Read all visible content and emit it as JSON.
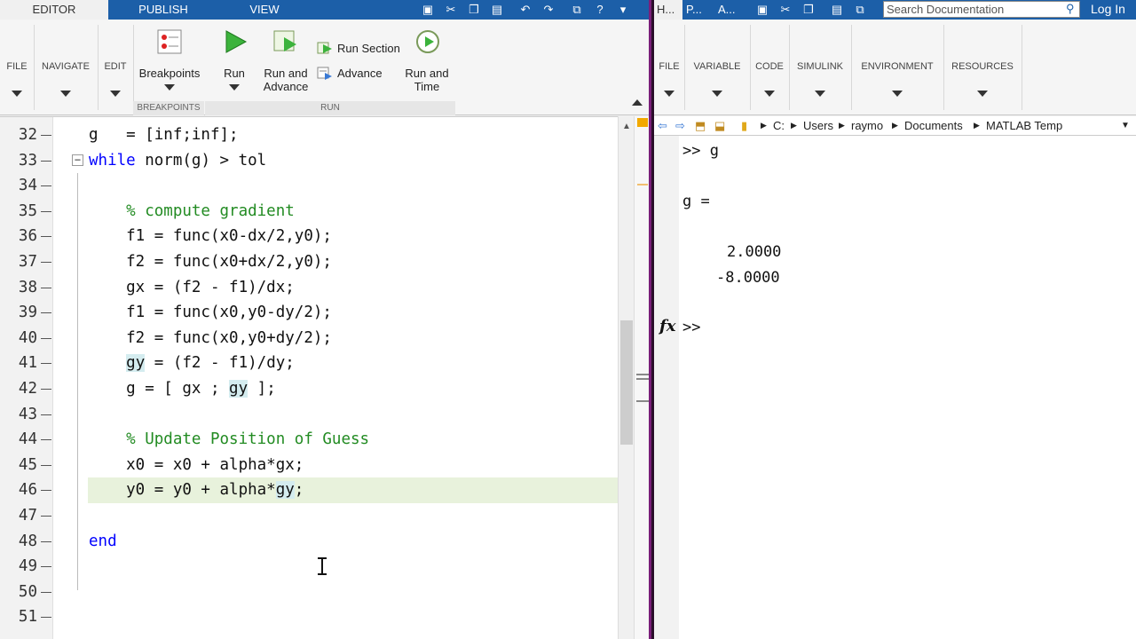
{
  "editor_window": {
    "tabs": [
      {
        "label": "EDITOR",
        "active": true
      },
      {
        "label": "PUBLISH",
        "active": false
      },
      {
        "label": "VIEW",
        "active": false
      }
    ],
    "ribbon": {
      "file": "FILE",
      "navigate": "NAVIGATE",
      "edit": "EDIT",
      "breakpoints": "Breakpoints",
      "run": "Run",
      "run_and_advance": [
        "Run and",
        "Advance"
      ],
      "run_section": "Run Section",
      "advance": "Advance",
      "run_and_time": [
        "Run and",
        "Time"
      ],
      "group_breakpoints": "BREAKPOINTS",
      "group_run": "RUN"
    },
    "code_lines": [
      {
        "num": "32",
        "text": "g   = [inf;inf];"
      },
      {
        "num": "33",
        "text": "while norm(g) > tol"
      },
      {
        "num": "34",
        "text": ""
      },
      {
        "num": "35",
        "text": "    % compute gradient"
      },
      {
        "num": "36",
        "text": "    f1 = func(x0-dx/2,y0);"
      },
      {
        "num": "37",
        "text": "    f2 = func(x0+dx/2,y0);"
      },
      {
        "num": "38",
        "text": "    gx = (f2 - f1)/dx;"
      },
      {
        "num": "39",
        "text": "    f1 = func(x0,y0-dy/2);"
      },
      {
        "num": "40",
        "text": "    f2 = func(x0,y0+dy/2);"
      },
      {
        "num": "41",
        "text": "    gy = (f2 - f1)/dy;"
      },
      {
        "num": "42",
        "text": "    g = [ gx ; gy ];"
      },
      {
        "num": "43",
        "text": ""
      },
      {
        "num": "44",
        "text": "    % Update Position of Guess"
      },
      {
        "num": "45",
        "text": "    x0 = x0 + alpha*gx;"
      },
      {
        "num": "46",
        "text": "    y0 = y0 + alpha*gy;"
      },
      {
        "num": "47",
        "text": ""
      },
      {
        "num": "48",
        "text": "end"
      },
      {
        "num": "49",
        "text": ""
      },
      {
        "num": "50",
        "text": ""
      },
      {
        "num": "51",
        "text": ""
      }
    ]
  },
  "command_window": {
    "tabs": [
      "H...",
      "P...",
      "A..."
    ],
    "search_placeholder": "Search Documentation",
    "login": "Log In",
    "ribbon": [
      "FILE",
      "VARIABLE",
      "CODE",
      "SIMULINK",
      "ENVIRONMENT",
      "RESOURCES"
    ],
    "path": [
      "C:",
      "Users",
      "raymo",
      "Documents",
      "MATLAB Temp"
    ],
    "prompt_cmd": ">> g",
    "var_header": "g =",
    "values": [
      "2.0000",
      "-8.0000"
    ],
    "fx_label": "fx",
    "prompt": ">>"
  },
  "colors": {
    "tab_bar": "#1c5fa8",
    "keyword": "#0000ff",
    "comment": "#228b22",
    "highlight": "#d4ecef",
    "current_line": "#e8f2dc"
  }
}
